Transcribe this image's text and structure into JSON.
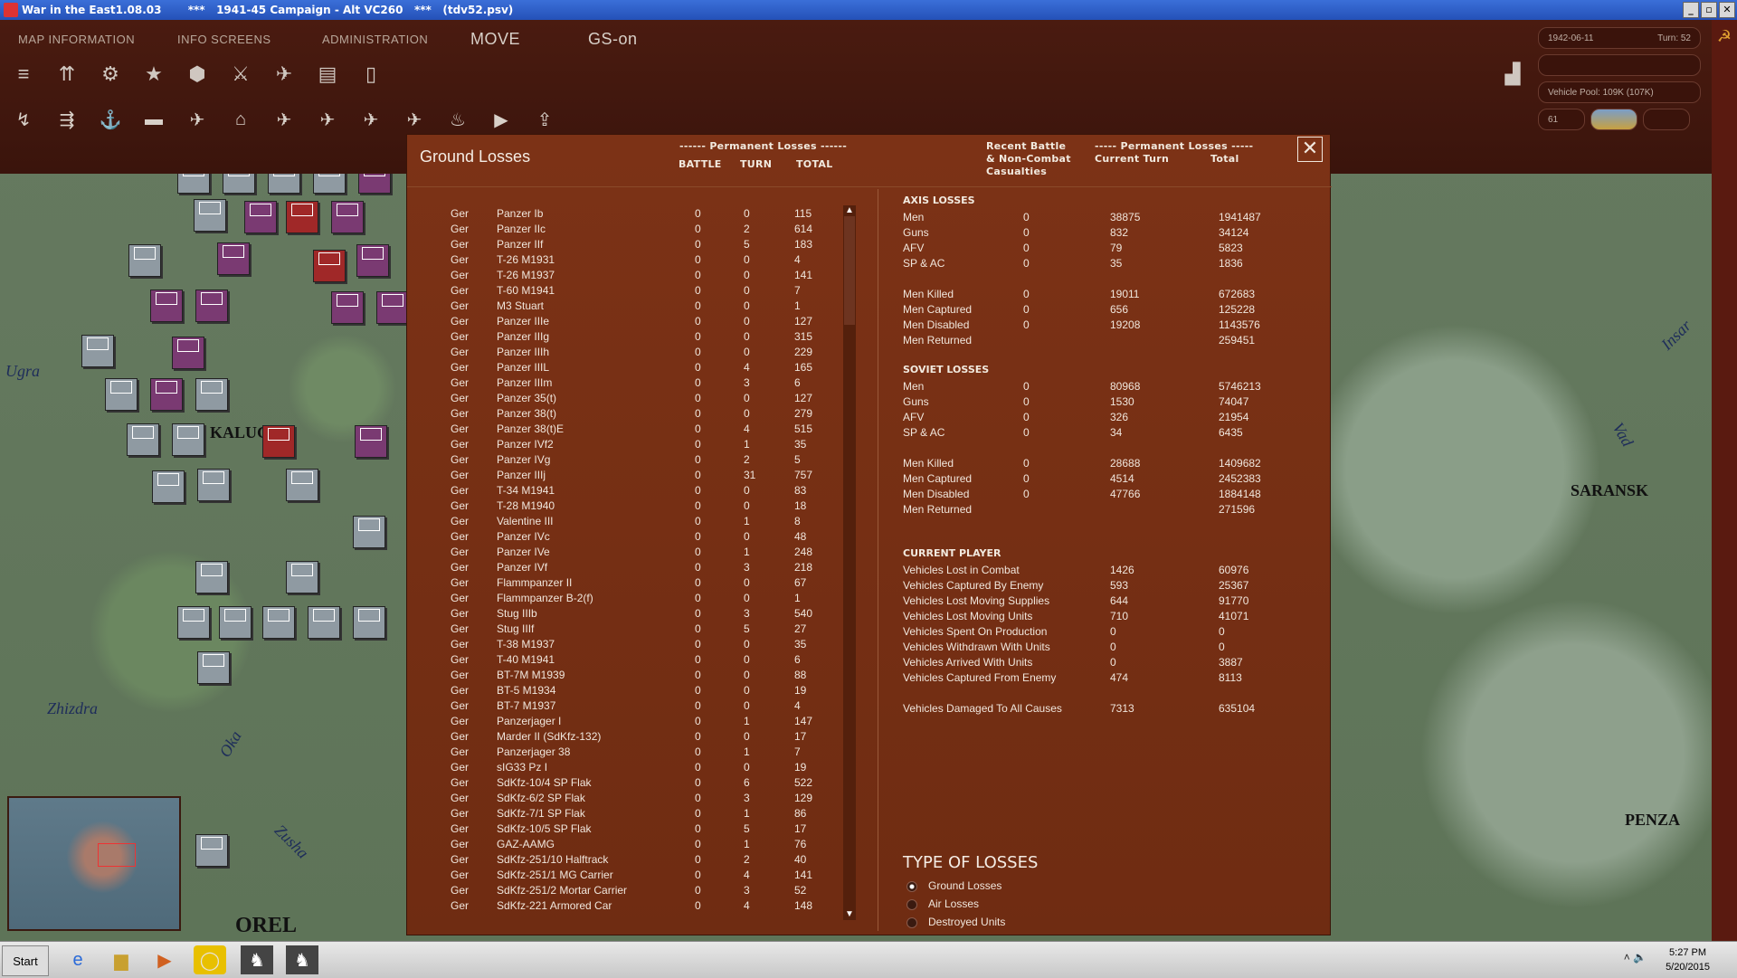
{
  "window": {
    "title": "War in the East1.08.03       ***   1941-45 Campaign - Alt VC260   ***   (tdv52.psv)",
    "min": "_",
    "max": "▫",
    "close": "✕"
  },
  "menu": {
    "map_information": "MAP INFORMATION",
    "info_screens": "INFO SCREENS",
    "administration": "ADMINISTRATION",
    "move": "MOVE",
    "gs_on": "GS-on"
  },
  "info": {
    "date": "1942-06-11",
    "turn": "Turn: 52",
    "vehicle_pool": "Vehicle Pool: 109K (107K)",
    "count": "61"
  },
  "map": {
    "labels": [
      "Ugra",
      "Zhizdra",
      "Oka",
      "Zusha",
      "Insar",
      "Vad"
    ],
    "cities": [
      "KALUGA",
      "OREL",
      "SARANSK",
      "PENZA"
    ]
  },
  "dialog": {
    "title": "Ground Losses",
    "perm_losses_header": "------ Permanent Losses ------",
    "col_battle": "BATTLE",
    "col_turn": "TURN",
    "col_total": "TOTAL",
    "recent_header_1": "Recent Battle",
    "recent_header_2": "& Non-Combat",
    "recent_header_3": "Casualties",
    "perm_losses_header2": "----- Permanent Losses -----",
    "col_current_turn": "Current Turn",
    "col_total2": "Total",
    "close_symbol": "✕",
    "scroll_up": "▲",
    "scroll_down": "▼",
    "rows": [
      [
        "Ger",
        "Panzer Ib",
        "0",
        "0",
        "115"
      ],
      [
        "Ger",
        "Panzer IIc",
        "0",
        "2",
        "614"
      ],
      [
        "Ger",
        "Panzer IIf",
        "0",
        "5",
        "183"
      ],
      [
        "Ger",
        "T-26 M1931",
        "0",
        "0",
        "4"
      ],
      [
        "Ger",
        "T-26 M1937",
        "0",
        "0",
        "141"
      ],
      [
        "Ger",
        "T-60 M1941",
        "0",
        "0",
        "7"
      ],
      [
        "Ger",
        "M3 Stuart",
        "0",
        "0",
        "1"
      ],
      [
        "Ger",
        "Panzer IIIe",
        "0",
        "0",
        "127"
      ],
      [
        "Ger",
        "Panzer IIIg",
        "0",
        "0",
        "315"
      ],
      [
        "Ger",
        "Panzer IIIh",
        "0",
        "0",
        "229"
      ],
      [
        "Ger",
        "Panzer IIIL",
        "0",
        "4",
        "165"
      ],
      [
        "Ger",
        "Panzer IIIm",
        "0",
        "3",
        "6"
      ],
      [
        "Ger",
        "Panzer 35(t)",
        "0",
        "0",
        "127"
      ],
      [
        "Ger",
        "Panzer 38(t)",
        "0",
        "0",
        "279"
      ],
      [
        "Ger",
        "Panzer 38(t)E",
        "0",
        "4",
        "515"
      ],
      [
        "Ger",
        "Panzer IVf2",
        "0",
        "1",
        "35"
      ],
      [
        "Ger",
        "Panzer IVg",
        "0",
        "2",
        "5"
      ],
      [
        "Ger",
        "Panzer IIIj",
        "0",
        "31",
        "757"
      ],
      [
        "Ger",
        "T-34 M1941",
        "0",
        "0",
        "83"
      ],
      [
        "Ger",
        "T-28 M1940",
        "0",
        "0",
        "18"
      ],
      [
        "Ger",
        "Valentine III",
        "0",
        "1",
        "8"
      ],
      [
        "Ger",
        "Panzer IVc",
        "0",
        "0",
        "48"
      ],
      [
        "Ger",
        "Panzer IVe",
        "0",
        "1",
        "248"
      ],
      [
        "Ger",
        "Panzer IVf",
        "0",
        "3",
        "218"
      ],
      [
        "Ger",
        "Flammpanzer II",
        "0",
        "0",
        "67"
      ],
      [
        "Ger",
        "Flammpanzer B-2(f)",
        "0",
        "0",
        "1"
      ],
      [
        "Ger",
        "Stug IIIb",
        "0",
        "3",
        "540"
      ],
      [
        "Ger",
        "Stug IIIf",
        "0",
        "5",
        "27"
      ],
      [
        "Ger",
        "T-38 M1937",
        "0",
        "0",
        "35"
      ],
      [
        "Ger",
        "T-40 M1941",
        "0",
        "0",
        "6"
      ],
      [
        "Ger",
        "BT-7M M1939",
        "0",
        "0",
        "88"
      ],
      [
        "Ger",
        "BT-5 M1934",
        "0",
        "0",
        "19"
      ],
      [
        "Ger",
        "BT-7 M1937",
        "0",
        "0",
        "4"
      ],
      [
        "Ger",
        "Panzerjager I",
        "0",
        "1",
        "147"
      ],
      [
        "Ger",
        "Marder II (SdKfz-132)",
        "0",
        "0",
        "17"
      ],
      [
        "Ger",
        "Panzerjager 38",
        "0",
        "1",
        "7"
      ],
      [
        "Ger",
        "sIG33 Pz I",
        "0",
        "0",
        "19"
      ],
      [
        "Ger",
        "SdKfz-10/4 SP Flak",
        "0",
        "6",
        "522"
      ],
      [
        "Ger",
        "SdKfz-6/2 SP Flak",
        "0",
        "3",
        "129"
      ],
      [
        "Ger",
        "SdKfz-7/1 SP Flak",
        "0",
        "1",
        "86"
      ],
      [
        "Ger",
        "SdKfz-10/5 SP Flak",
        "0",
        "5",
        "17"
      ],
      [
        "Ger",
        "GAZ-AAMG",
        "0",
        "1",
        "76"
      ],
      [
        "Ger",
        "SdKfz-251/10 Halftrack",
        "0",
        "2",
        "40"
      ],
      [
        "Ger",
        "SdKfz-251/1 MG Carrier",
        "0",
        "4",
        "141"
      ],
      [
        "Ger",
        "SdKfz-251/2 Mortar Carrier",
        "0",
        "3",
        "52"
      ],
      [
        "Ger",
        "SdKfz-221 Armored Car",
        "0",
        "4",
        "148"
      ]
    ],
    "axis": {
      "header": "AXIS LOSSES",
      "rows": [
        [
          "Men",
          "0",
          "38875",
          "1941487"
        ],
        [
          "Guns",
          "0",
          "832",
          "34124"
        ],
        [
          "AFV",
          "0",
          "79",
          "5823"
        ],
        [
          "SP & AC",
          "0",
          "35",
          "1836"
        ],
        [
          "Men Killed",
          "0",
          "19011",
          "672683"
        ],
        [
          "Men Captured",
          "0",
          "656",
          "125228"
        ],
        [
          "Men Disabled",
          "0",
          "19208",
          "1143576"
        ],
        [
          "Men Returned",
          "",
          "",
          "259451"
        ]
      ]
    },
    "soviet": {
      "header": "SOVIET LOSSES",
      "rows": [
        [
          "Men",
          "0",
          "80968",
          "5746213"
        ],
        [
          "Guns",
          "0",
          "1530",
          "74047"
        ],
        [
          "AFV",
          "0",
          "326",
          "21954"
        ],
        [
          "SP & AC",
          "0",
          "34",
          "6435"
        ],
        [
          "Men Killed",
          "0",
          "28688",
          "1409682"
        ],
        [
          "Men Captured",
          "0",
          "4514",
          "2452383"
        ],
        [
          "Men Disabled",
          "0",
          "47766",
          "1884148"
        ],
        [
          "Men Returned",
          "",
          "",
          "271596"
        ]
      ]
    },
    "player": {
      "header": "CURRENT PLAYER",
      "rows": [
        [
          "Vehicles Lost in Combat",
          "1426",
          "60976"
        ],
        [
          "Vehicles Captured By Enemy",
          "593",
          "25367"
        ],
        [
          "Vehicles Lost Moving Supplies",
          "644",
          "91770"
        ],
        [
          "Vehicles Lost Moving Units",
          "710",
          "41071"
        ],
        [
          "Vehicles Spent On Production",
          "0",
          "0"
        ],
        [
          "Vehicles Withdrawn With Units",
          "0",
          "0"
        ],
        [
          "Vehicles Arrived With Units",
          "0",
          "3887"
        ],
        [
          "Vehicles Captured From Enemy",
          "474",
          "8113"
        ],
        [
          "Vehicles Damaged To All Causes",
          "7313",
          "635104"
        ]
      ]
    },
    "type_of_losses": {
      "header": "TYPE OF LOSSES",
      "options": [
        "Ground Losses",
        "Air Losses",
        "Destroyed Units"
      ],
      "selected": "Ground Losses"
    }
  },
  "taskbar": {
    "start": "Start",
    "time": "5:27 PM",
    "date": "5/20/2015"
  }
}
